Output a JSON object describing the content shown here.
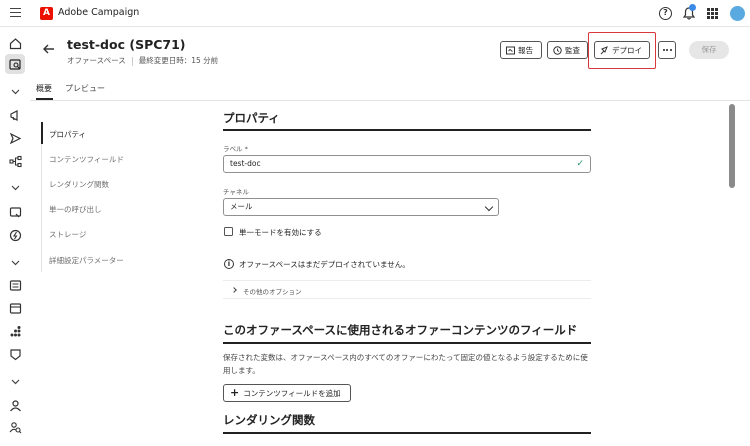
{
  "app": {
    "title": "Adobe Campaign",
    "logo_letter": "A",
    "brand_color": "#eb1000"
  },
  "header": {
    "title": "test-doc (SPC71)",
    "subtitle_type": "オファースペース",
    "subtitle_modified": "最終変更日時：15 分前",
    "buttons": {
      "report": "報告",
      "audit": "監査",
      "deploy": "デプロイ",
      "save": "保存"
    }
  },
  "tabs": [
    {
      "label": "概要",
      "active": true
    },
    {
      "label": "プレビュー",
      "active": false
    }
  ],
  "left_nav": {
    "items": [
      {
        "label": "プロパティ",
        "active": true
      },
      {
        "label": "コンテンツフィールド"
      },
      {
        "label": "レンダリング関数"
      },
      {
        "label": "単一の呼び出し"
      },
      {
        "label": "ストレージ"
      },
      {
        "label": "詳細設定パラメーター"
      }
    ]
  },
  "properties": {
    "section_title": "プロパティ",
    "label_field_label": "ラベル",
    "required_marker": "*",
    "label_value": "test-doc",
    "channel_label": "チャネル",
    "channel_value": "メール",
    "single_mode_label": "単一モードを有効にする",
    "single_mode_checked": false,
    "info_text": "オファースペースはまだデプロイされていません。",
    "more_options": "その他のオプション"
  },
  "content_fields": {
    "section_title": "このオファースペースに使用されるオファーコンテンツのフィールド",
    "description": "保存された変数は、オファースペース内のすべてのオファーにわたって固定の値となるよう設定するために使用します。",
    "add_button": "コンテンツフィールドを追加"
  },
  "rendering": {
    "section_title": "レンダリング関数"
  },
  "icons": {
    "rail": [
      "home-icon",
      "explorer-icon",
      "chevron-down-icon",
      "campaign-icon",
      "send-icon",
      "workflow-icon",
      "chevron-down-icon",
      "deliveries-icon",
      "offers-icon",
      "chevron-down-icon",
      "reports-icon",
      "catalog-icon",
      "audience-icon",
      "badge-icon",
      "chevron-down-icon",
      "profile-icon",
      "search-people-icon"
    ]
  }
}
